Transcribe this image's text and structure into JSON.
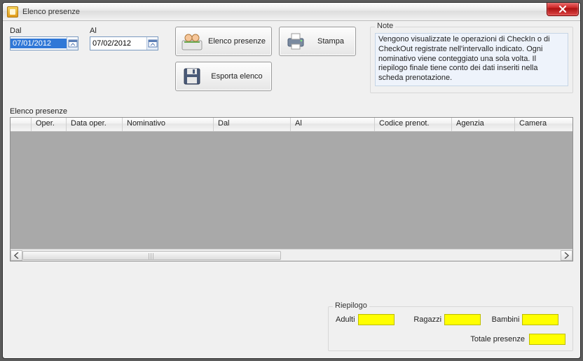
{
  "window": {
    "title": "Elenco presenze"
  },
  "dates": {
    "from_label": "Dal",
    "to_label": "Al",
    "from_value": "07/01/2012",
    "to_value": "07/02/2012"
  },
  "buttons": {
    "elenco_presenze": "Elenco presenze",
    "stampa": "Stampa",
    "esporta_elenco": "Esporta elenco"
  },
  "note": {
    "legend": "Note",
    "text": "Vengono visualizzate le operazioni di CheckIn o di CheckOut registrate nell'intervallo indicato. Ogni nominativo viene conteggiato una sola volta. Il riepilogo finale tiene conto dei dati inseriti nella scheda prenotazione."
  },
  "grid": {
    "label": "Elenco presenze",
    "columns": [
      "",
      "Oper.",
      "Data oper.",
      "Nominativo",
      "Dal",
      "Al",
      "Codice prenot.",
      "Agenzia",
      "Camera"
    ],
    "rows": []
  },
  "riepilogo": {
    "legend": "Riepilogo",
    "adulti_label": "Adulti",
    "ragazzi_label": "Ragazzi",
    "bambini_label": "Bambini",
    "totale_label": "Totale presenze",
    "adulti": "",
    "ragazzi": "",
    "bambini": "",
    "totale": ""
  }
}
